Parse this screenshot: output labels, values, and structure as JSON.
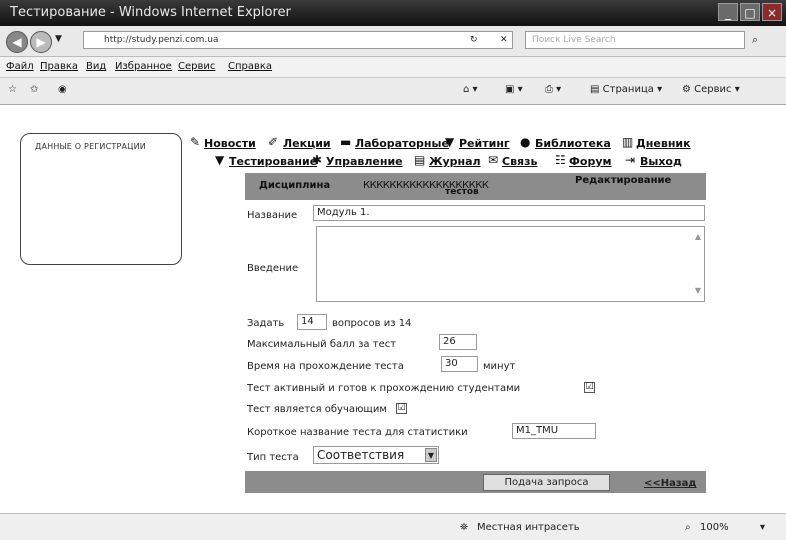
{
  "window": {
    "title": "Тестирование - Windows Internet Explorer",
    "minimize_glyph": "_",
    "maximize_glyph": "□",
    "close_glyph": "×"
  },
  "addressbar": {
    "url": "http://study.penzi.com.ua",
    "search_placeholder": "Поиск Live Search"
  },
  "menu": [
    "Файл",
    "Правка",
    "Вид",
    "Избранное",
    "Сервис",
    "Справка"
  ],
  "command_bar": {
    "page_label": "Страница",
    "tools_label": "Сервис"
  },
  "sidebar": {
    "header": "ДАННЫЕ О РЕГИСТРАЦИИ"
  },
  "nav": {
    "row1": [
      "Новости",
      "Лекции",
      "Лабораторные",
      "Рейтинг",
      "Библиотека",
      "Дневник"
    ],
    "row2": [
      "Тестирование",
      "Управление",
      "Журнал",
      "Связь",
      "Форум",
      "Выход"
    ]
  },
  "header_bar": {
    "discipline_label": "Дисциплина",
    "discipline_value": "ККККККККККККККККККК",
    "edit_label": "Редактирование",
    "edit_label2": "тестов"
  },
  "form": {
    "name_label": "Название",
    "name_value": "Модуль 1.",
    "intro_label": "Введение",
    "ask_label": "Задать",
    "ask_value": "14",
    "ask_suffix": "вопросов из 14",
    "max_score_label": "Максимальный балл за тест",
    "max_score_value": "26",
    "time_label": "Время на прохождение теста",
    "time_value": "30",
    "time_suffix": "минут",
    "active_label": "Тест активный и готов к прохождению студентами",
    "active_checked": "☑",
    "training_label": "Тест является обучающим",
    "training_checked": "☑",
    "short_name_label": "Короткое название теста для статистики",
    "short_name_value": "M1_TMU",
    "type_label": "Тип теста",
    "type_value": "Соответствия"
  },
  "actions": {
    "submit_label": "Подача запроса",
    "back_label": "<<Назад"
  },
  "statusbar": {
    "zone": "Местная интрасеть",
    "zoom": "100%"
  }
}
